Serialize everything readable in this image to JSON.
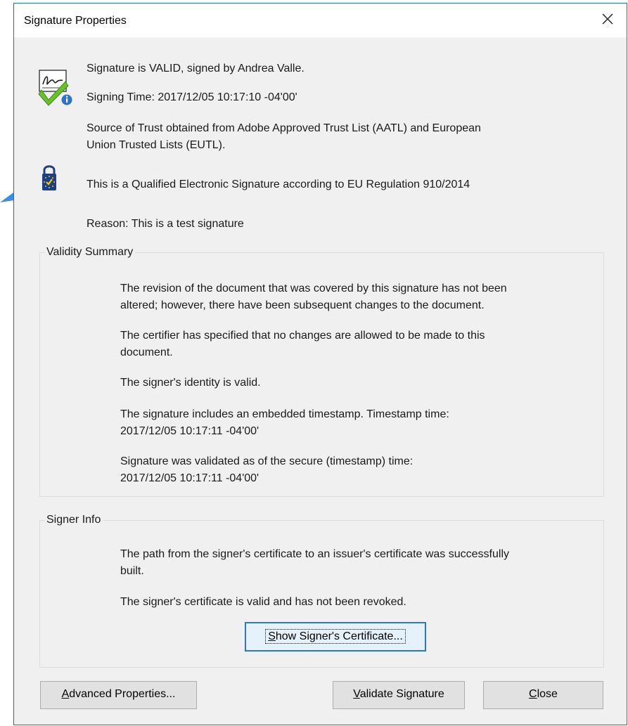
{
  "window": {
    "title": "Signature Properties"
  },
  "summary": {
    "status": "Signature is VALID, signed by Andrea Valle.",
    "signing_time": "Signing Time:  2017/12/05 10:17:10 -04'00'",
    "trust_line1": "Source of Trust obtained from Adobe Approved Trust List (AATL) and European",
    "trust_line2": "Union Trusted Lists (EUTL).",
    "qualified": "This is a Qualified Electronic Signature according to EU Regulation 910/2014",
    "reason": "Reason:  This is a test signature"
  },
  "validity": {
    "legend": "Validity Summary",
    "items": [
      [
        "The revision of the document that was covered by this signature has not been",
        "altered; however, there have been subsequent changes to the document."
      ],
      [
        "The certifier has specified that no changes are allowed to be made to this",
        "document."
      ],
      [
        "The signer's identity is valid."
      ],
      [
        "The signature includes an embedded timestamp. Timestamp time:",
        "2017/12/05 10:17:11 -04'00'"
      ],
      [
        "Signature was validated as of the secure (timestamp) time:",
        "2017/12/05 10:17:11 -04'00'"
      ]
    ]
  },
  "signer": {
    "legend": "Signer Info",
    "path_line1": "The path from the signer's certificate to an issuer's certificate was successfully",
    "path_line2": "built.",
    "cert_valid": "The signer's certificate is valid and has not been revoked.",
    "show_cert_mnemonic": "S",
    "show_cert_rest": "how Signer's Certificate..."
  },
  "buttons": {
    "advanced_mnemonic": "A",
    "advanced_rest": "dvanced Properties...",
    "validate_mnemonic": "V",
    "validate_rest": "alidate Signature",
    "close_mnemonic": "C",
    "close_rest": "lose"
  },
  "colors": {
    "accent": "#2a78d6",
    "arrow": "#3b8de6",
    "window_border": "#1f6fb5"
  },
  "icons": {
    "signature": "signature-valid-icon",
    "lock": "eu-qualified-lock-icon",
    "close": "close-icon",
    "pointer": "pointer-arrow-icon"
  }
}
